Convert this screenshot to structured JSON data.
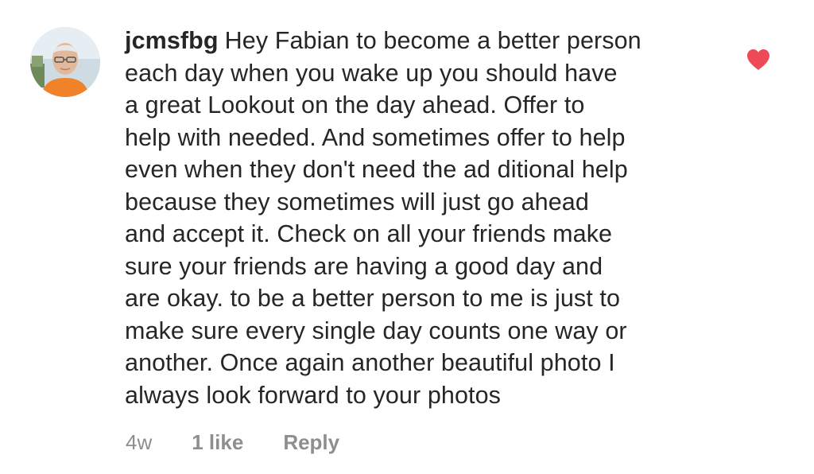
{
  "comment": {
    "username": "jcmsfbg",
    "lines": [
      "Hey Fabian to become a better person",
      "each day when you wake up you should have",
      "a great Lookout on the day ahead. Offer to",
      "help with needed. And sometimes offer to help",
      "even when they don't need the ad ditional help",
      "because they sometimes will just go ahead",
      "and accept it. Check on all your friends make",
      "sure your friends are having a good day and",
      "are okay. to be a better person to me is just to",
      "make sure every single day counts one way or",
      "another. Once again another beautiful photo I",
      "always look forward to your photos"
    ],
    "timestamp": "4w",
    "likes_label": "1 like",
    "reply_label": "Reply",
    "liked": true,
    "heart_icon": "heart-filled-icon",
    "heart_color": "#ed4956",
    "meta_color": "#8e8e8e",
    "text_color": "#262626"
  }
}
